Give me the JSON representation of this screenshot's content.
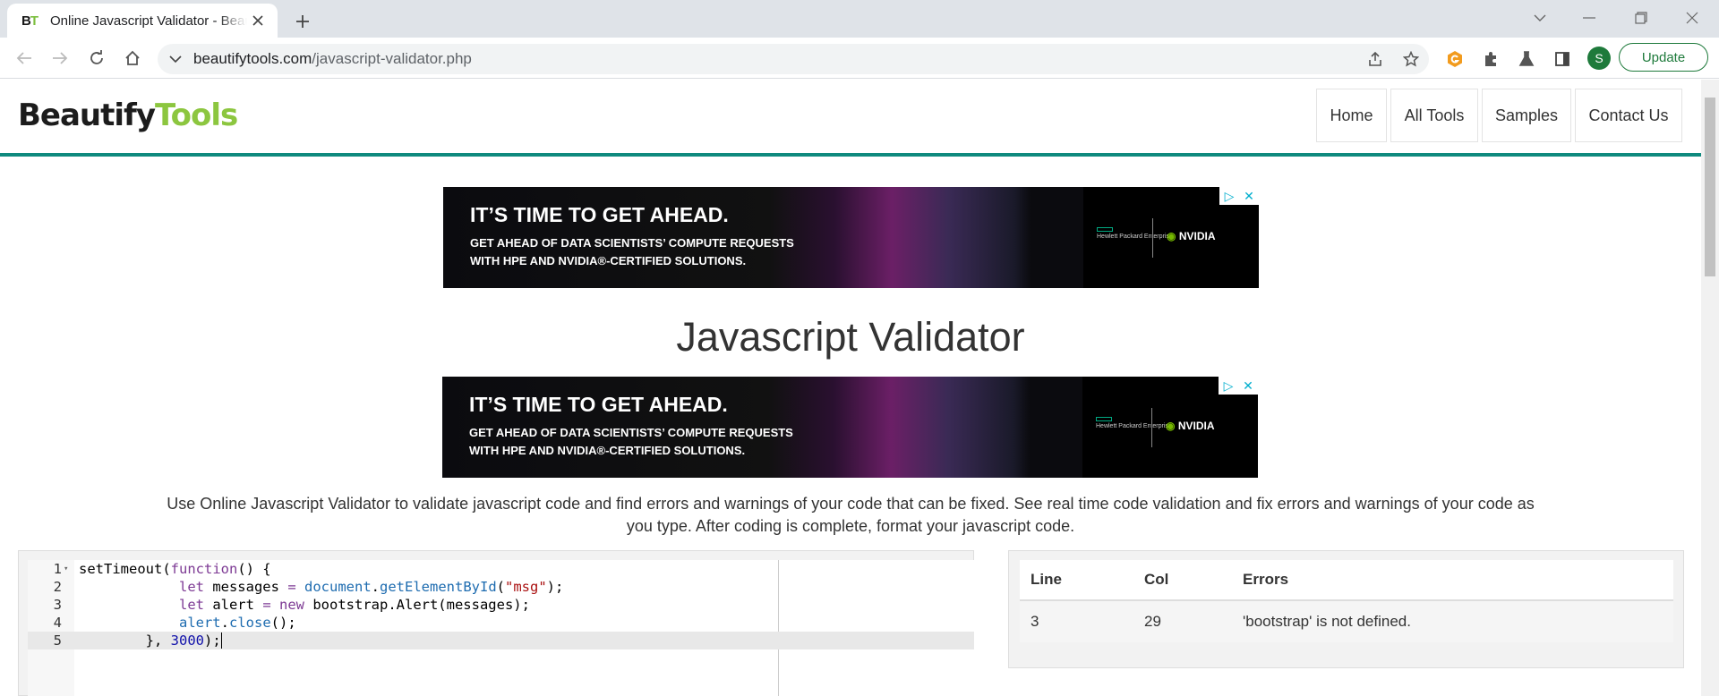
{
  "browser": {
    "tab_title": "Online Javascript Validator - Beautify Tools",
    "favicon_letters": [
      "B",
      "T"
    ],
    "url_domain": "beautifytools.com",
    "url_path": "/javascript-validator.php",
    "profile_initial": "S",
    "update_label": "Update"
  },
  "site": {
    "logo_part1": "Beautify",
    "logo_part2": "Tools",
    "nav": [
      "Home",
      "All Tools",
      "Samples",
      "Contact Us"
    ]
  },
  "ads": {
    "line1": "IT’S TIME TO GET AHEAD.",
    "line2": "GET AHEAD OF DATA SCIENTISTS’ COMPUTE REQUESTS",
    "line3": "WITH HPE AND NVIDIA®-CERTIFIED  SOLUTIONS.",
    "hpe": "Hewlett Packard Enterprise",
    "nvidia": "NVIDIA"
  },
  "main": {
    "title": "Javascript Validator",
    "intro": "Use Online Javascript Validator to validate javascript code and find errors and warnings of your code that can be fixed. See real time code validation and fix errors and warnings of your code as you type. After coding is complete, format your javascript code."
  },
  "editor": {
    "line_numbers": [
      "1",
      "2",
      "3",
      "4",
      "5"
    ],
    "lines": [
      "setTimeout(function() {",
      "            let messages = document.getElementById(\"msg\");",
      "            let alert = new bootstrap.Alert(messages);",
      "            alert.close();",
      "        }, 3000);"
    ]
  },
  "results": {
    "headers": [
      "Line",
      "Col",
      "Errors"
    ],
    "rows": [
      {
        "line": "3",
        "col": "29",
        "error": "'bootstrap' is not defined."
      }
    ]
  },
  "colors": {
    "accent": "#0f8a7e",
    "logo_green": "#8cc63f",
    "profile_green": "#1e7a3b"
  }
}
